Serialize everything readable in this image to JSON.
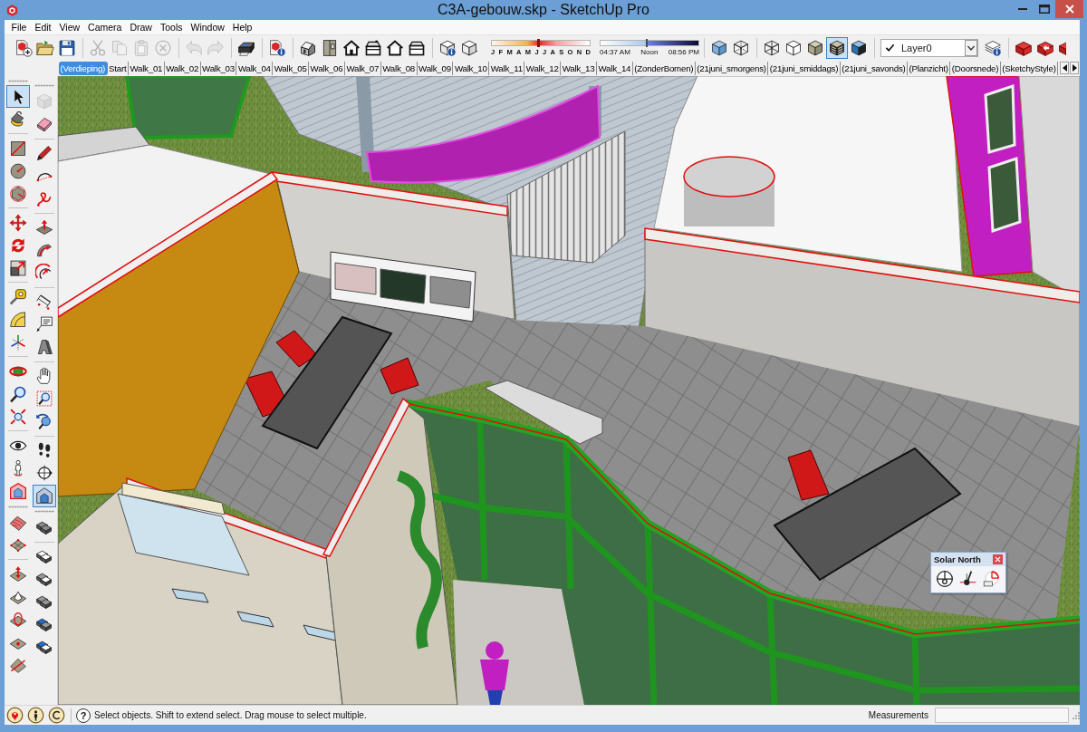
{
  "window": {
    "title": "C3A-gebouw.skp - SketchUp Pro"
  },
  "menu": [
    "File",
    "Edit",
    "View",
    "Camera",
    "Draw",
    "Tools",
    "Window",
    "Help"
  ],
  "toolbar": [
    {
      "kind": "buttons",
      "buttons": [
        {
          "disabled": false
        },
        {
          "disabled": false
        },
        {
          "disabled": false
        }
      ]
    },
    {
      "kind": "buttons",
      "buttons": [
        {
          "disabled": true
        },
        {
          "disabled": true
        },
        {
          "disabled": true
        },
        {
          "disabled": true
        }
      ]
    },
    {
      "kind": "buttons",
      "buttons": [
        {
          "disabled": true
        },
        {
          "disabled": true
        }
      ]
    },
    {
      "kind": "buttons",
      "buttons": [
        {
          "disabled": false
        }
      ]
    },
    {
      "kind": "buttons",
      "buttons": [
        {
          "disabled": false
        }
      ]
    },
    {
      "kind": "buttons",
      "buttons": [
        {
          "disabled": false
        },
        {
          "disabled": false
        },
        {
          "disabled": false
        },
        {
          "disabled": false
        },
        {
          "disabled": false
        },
        {
          "disabled": false
        }
      ]
    },
    {
      "kind": "shadows",
      "buttons": [
        {
          "disabled": false
        },
        {
          "disabled": false
        }
      ],
      "month_slider": {
        "labels": [
          "J",
          "F",
          "M",
          "A",
          "M",
          "J",
          "J",
          "A",
          "S",
          "O",
          "N",
          "D"
        ],
        "level": 0.48
      },
      "time_slider": {
        "labels": [
          "04:37 AM",
          "Noon",
          "08:56 PM"
        ],
        "level": 0.47
      }
    },
    {
      "kind": "buttons",
      "buttons": [
        {
          "selected": false,
          "disabled": false
        },
        {
          "selected": false,
          "disabled": false
        }
      ]
    },
    {
      "kind": "buttons",
      "buttons": [
        {
          "selected": false,
          "disabled": false
        },
        {
          "selected": false,
          "disabled": false
        },
        {
          "selected": false,
          "disabled": false
        },
        {
          "selected": true,
          "disabled": false
        },
        {
          "selected": false,
          "disabled": false
        }
      ]
    },
    {
      "kind": "layers",
      "layer": "Layer0",
      "buttons": [
        {
          "disabled": false
        }
      ]
    },
    {
      "kind": "buttons",
      "buttons": [
        {
          "disabled": false
        },
        {
          "disabled": false
        },
        {
          "disabled": false
        }
      ]
    }
  ],
  "scene_tabs": [
    {
      "label": "(Verdieping)",
      "selected": true
    },
    {
      "label": "Start",
      "selected": false
    },
    {
      "label": "Walk_01",
      "selected": false
    },
    {
      "label": "Walk_02",
      "selected": false
    },
    {
      "label": "Walk_03",
      "selected": false
    },
    {
      "label": "Walk_04",
      "selected": false
    },
    {
      "label": "Walk_05",
      "selected": false
    },
    {
      "label": "Walk_06",
      "selected": false
    },
    {
      "label": "Walk_07",
      "selected": false
    },
    {
      "label": "Walk_08",
      "selected": false
    },
    {
      "label": "Walk_09",
      "selected": false
    },
    {
      "label": "Walk_10",
      "selected": false
    },
    {
      "label": "Walk_11",
      "selected": false
    },
    {
      "label": "Walk_12",
      "selected": false
    },
    {
      "label": "Walk_13",
      "selected": false
    },
    {
      "label": "Walk_14",
      "selected": false
    },
    {
      "label": "(ZonderBomen)",
      "selected": false
    },
    {
      "label": "(21juni_smorgens)",
      "selected": false
    },
    {
      "label": "(21juni_smiddags)",
      "selected": false
    },
    {
      "label": "(21juni_savonds)",
      "selected": false
    },
    {
      "label": "(Planzicht)",
      "selected": false
    },
    {
      "label": "(Doorsnede)",
      "selected": false
    },
    {
      "label": "(SketchyStyle)",
      "selected": false
    }
  ],
  "tool_palette": {
    "columns": [
      {
        "toolbars": [
          {
            "groups": [
              [
                {
                  "selected": true,
                  "disabled": false
                },
                {
                  "selected": false,
                  "disabled": false
                }
              ],
              [
                {
                  "selected": false,
                  "disabled": false
                },
                {
                  "selected": false,
                  "disabled": false
                },
                {
                  "selected": false,
                  "disabled": false
                }
              ],
              [
                {
                  "selected": false,
                  "disabled": false
                },
                {
                  "selected": false,
                  "disabled": false
                },
                {
                  "selected": false,
                  "disabled": false
                }
              ],
              [
                {
                  "selected": false,
                  "disabled": false
                },
                {
                  "selected": false,
                  "disabled": false
                },
                {
                  "selected": false,
                  "disabled": false
                }
              ],
              [
                {
                  "selected": false,
                  "disabled": false
                },
                {
                  "selected": false,
                  "disabled": false
                },
                {
                  "selected": false,
                  "disabled": false
                }
              ],
              [
                {
                  "selected": false,
                  "disabled": false
                },
                {
                  "selected": false,
                  "disabled": false
                },
                {
                  "selected": false,
                  "disabled": false
                }
              ]
            ]
          },
          {
            "groups": [
              [
                {
                  "selected": false,
                  "disabled": false
                },
                {
                  "selected": false,
                  "disabled": false
                }
              ],
              [
                {
                  "selected": false,
                  "disabled": false
                },
                {
                  "selected": false,
                  "disabled": false
                },
                {
                  "selected": false,
                  "disabled": false
                },
                {
                  "selected": false,
                  "disabled": false
                },
                {
                  "selected": false,
                  "disabled": false
                }
              ]
            ]
          }
        ]
      },
      {
        "toolbars": [
          {
            "groups": [
              [
                {
                  "selected": false,
                  "disabled": true
                },
                {
                  "selected": false,
                  "disabled": false
                }
              ],
              [
                {
                  "selected": false,
                  "disabled": false
                },
                {
                  "selected": false,
                  "disabled": false
                },
                {
                  "selected": false,
                  "disabled": false
                }
              ],
              [
                {
                  "selected": false,
                  "disabled": false
                },
                {
                  "selected": false,
                  "disabled": false
                },
                {
                  "selected": false,
                  "disabled": false
                }
              ],
              [
                {
                  "selected": false,
                  "disabled": false
                },
                {
                  "selected": false,
                  "disabled": false
                },
                {
                  "selected": false,
                  "disabled": false
                }
              ],
              [
                {
                  "selected": false,
                  "disabled": false
                },
                {
                  "selected": false,
                  "disabled": false
                },
                {
                  "selected": false,
                  "disabled": false
                }
              ],
              [
                {
                  "selected": false,
                  "disabled": false
                },
                {
                  "selected": false,
                  "disabled": false
                },
                {
                  "selected": true,
                  "disabled": false
                }
              ]
            ]
          },
          {
            "groups": [
              [
                {
                  "selected": false,
                  "disabled": false
                }
              ],
              [
                {
                  "selected": false,
                  "disabled": false
                },
                {
                  "selected": false,
                  "disabled": false
                },
                {
                  "selected": false,
                  "disabled": false
                },
                {
                  "selected": false,
                  "disabled": false
                },
                {
                  "selected": false,
                  "disabled": false
                }
              ]
            ]
          }
        ]
      }
    ]
  },
  "solar_north": {
    "title": "Solar North"
  },
  "status_bar": {
    "help_button": "?",
    "message": "Select objects. Shift to extend select. Drag mouse to select multiple.",
    "measurements_label": "Measurements"
  }
}
